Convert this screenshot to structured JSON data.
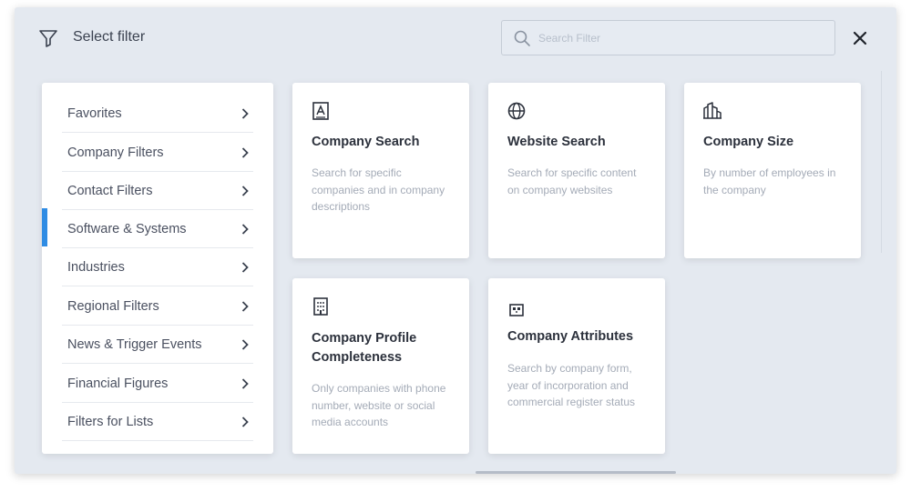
{
  "header": {
    "title": "Select filter",
    "search_placeholder": "Search Filter",
    "search_value": ""
  },
  "sidebar": {
    "active_index": 1,
    "items": [
      {
        "label": "Favorites"
      },
      {
        "label": "Company Filters"
      },
      {
        "label": "Contact Filters"
      },
      {
        "label": "Software & Systems"
      },
      {
        "label": "Industries"
      },
      {
        "label": "Regional Filters"
      },
      {
        "label": "News & Trigger Events"
      },
      {
        "label": "Financial Figures"
      },
      {
        "label": "Filters for Lists"
      }
    ]
  },
  "cards": [
    {
      "icon": "company-search-icon",
      "title": "Company Search",
      "description": "Search for specific companies and in company descriptions"
    },
    {
      "icon": "globe-icon",
      "title": "Website Search",
      "description": "Search for specific content on company websites"
    },
    {
      "icon": "buildings-icon",
      "title": "Company Size",
      "description": "By number of employees in the company"
    },
    {
      "icon": "office-building-icon",
      "title": "Company Profile Completeness",
      "description": "Only companies with phone number, website or social media accounts"
    },
    {
      "icon": "storefront-icon",
      "title": "Company Attributes",
      "description": "Search by company form, year of incorporation and commercial register status"
    }
  ],
  "colors": {
    "accent": "#2f8ce4",
    "modal_bg": "#e4e9f0",
    "card_bg": "#ffffff",
    "title_text": "#2c313c",
    "muted_text": "#a4abb7"
  }
}
